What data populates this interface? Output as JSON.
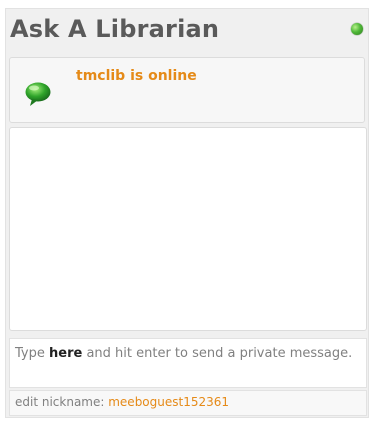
{
  "header": {
    "title": "Ask A Librarian",
    "status_icon": "online-indicator-icon",
    "status_color": "#4fb838"
  },
  "status": {
    "icon": "chat-bubble-icon",
    "text": "tmclib is online",
    "text_color": "#e58a18"
  },
  "chat": {
    "messages": []
  },
  "input": {
    "prefix": "Type ",
    "bold": "here",
    "suffix": " and hit enter to send a private message."
  },
  "nickname": {
    "label": "edit nickname: ",
    "value": "meeboguest152361"
  }
}
